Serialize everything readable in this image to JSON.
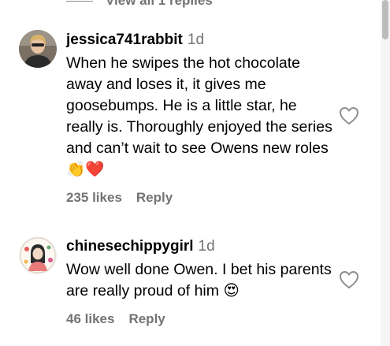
{
  "top": {
    "view_replies": "View all 1 replies"
  },
  "comments": [
    {
      "username": "jessica741rabbit",
      "time": "1d",
      "text": "When he swipes the hot chocolate away and loses it, it gives me goosebumps. He is a little star, he really is. Thoroughly enjoyed the series and can’t wait to see Owens new roles",
      "emojis": "👏❤️",
      "likes": "235 likes",
      "reply": "Reply",
      "avatar_icon": "user-photo-avatar"
    },
    {
      "username": "chinesechippygirl",
      "time": "1d",
      "text": "Wow well done Owen. I bet his parents are really proud of him",
      "emojis": "😍",
      "likes": "46 likes",
      "reply": "Reply",
      "avatar_icon": "illustrated-avatar"
    }
  ],
  "icons": {
    "like": "heart-outline-icon"
  },
  "colors": {
    "secondary_text": "#737373",
    "heart_stroke": "#8e8e8e"
  }
}
